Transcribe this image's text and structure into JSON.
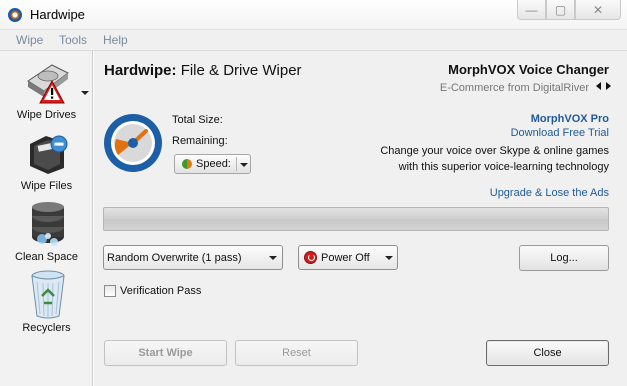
{
  "window": {
    "title": "Hardwipe",
    "minimize": "—",
    "maximize": "▢",
    "close": "✕"
  },
  "menu": [
    "Wipe",
    "Tools",
    "Help"
  ],
  "sidebar": [
    {
      "label": "Wipe Drives",
      "icon": "hard-drive-warning-icon"
    },
    {
      "label": "Wipe Files",
      "icon": "file-folder-remove-icon"
    },
    {
      "label": "Clean Space",
      "icon": "database-stack-icon"
    },
    {
      "label": "Recyclers",
      "icon": "recycle-bin-icon"
    }
  ],
  "header": {
    "title_bold": "Hardwipe:",
    "title_rest": "File & Drive Wiper"
  },
  "ad": {
    "title": "MorphVOX Voice Changer",
    "subtitle": "E-Commerce from DigitalRiver",
    "product": "MorphVOX Pro",
    "link": "Download Free Trial",
    "desc_line1": "Change your voice over Skype & online games",
    "desc_line2": "with this superior voice-learning technology",
    "upgrade": "Upgrade & Lose the Ads"
  },
  "status": {
    "total_size_label": "Total Size:",
    "remaining_label": "Remaining:",
    "speed_label": "Speed:"
  },
  "progress": {
    "value": 0
  },
  "controls": {
    "method": "Random Overwrite (1 pass)",
    "after_action": "Power Off",
    "log_button": "Log...",
    "verification_label": "Verification Pass",
    "verification_checked": false
  },
  "buttons": {
    "start": "Start Wipe",
    "reset": "Reset",
    "close": "Close"
  },
  "colors": {
    "link": "#1f5a96",
    "accent_orange": "#e07010",
    "accent_blue": "#1f5aa0",
    "power_red": "#d21d1d"
  }
}
